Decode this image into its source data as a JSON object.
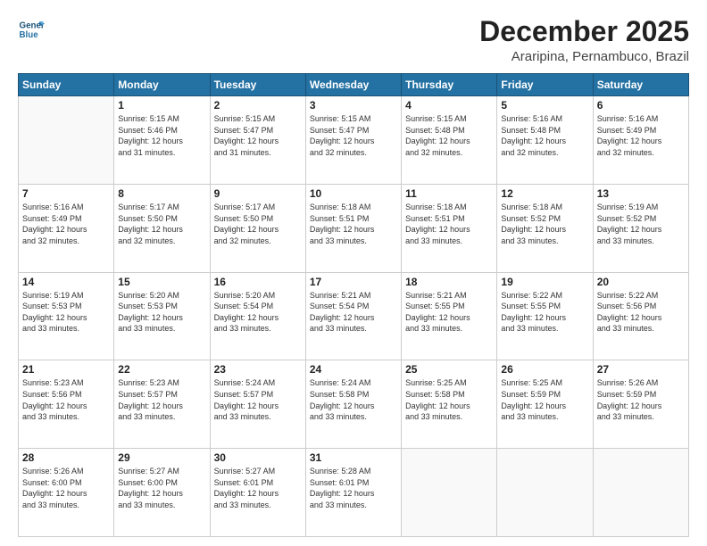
{
  "logo": {
    "line1": "General",
    "line2": "Blue"
  },
  "title": "December 2025",
  "subtitle": "Araripina, Pernambuco, Brazil",
  "weekdays": [
    "Sunday",
    "Monday",
    "Tuesday",
    "Wednesday",
    "Thursday",
    "Friday",
    "Saturday"
  ],
  "weeks": [
    [
      {
        "day": "",
        "info": ""
      },
      {
        "day": "1",
        "info": "Sunrise: 5:15 AM\nSunset: 5:46 PM\nDaylight: 12 hours\nand 31 minutes."
      },
      {
        "day": "2",
        "info": "Sunrise: 5:15 AM\nSunset: 5:47 PM\nDaylight: 12 hours\nand 31 minutes."
      },
      {
        "day": "3",
        "info": "Sunrise: 5:15 AM\nSunset: 5:47 PM\nDaylight: 12 hours\nand 32 minutes."
      },
      {
        "day": "4",
        "info": "Sunrise: 5:15 AM\nSunset: 5:48 PM\nDaylight: 12 hours\nand 32 minutes."
      },
      {
        "day": "5",
        "info": "Sunrise: 5:16 AM\nSunset: 5:48 PM\nDaylight: 12 hours\nand 32 minutes."
      },
      {
        "day": "6",
        "info": "Sunrise: 5:16 AM\nSunset: 5:49 PM\nDaylight: 12 hours\nand 32 minutes."
      }
    ],
    [
      {
        "day": "7",
        "info": "Sunrise: 5:16 AM\nSunset: 5:49 PM\nDaylight: 12 hours\nand 32 minutes."
      },
      {
        "day": "8",
        "info": "Sunrise: 5:17 AM\nSunset: 5:50 PM\nDaylight: 12 hours\nand 32 minutes."
      },
      {
        "day": "9",
        "info": "Sunrise: 5:17 AM\nSunset: 5:50 PM\nDaylight: 12 hours\nand 32 minutes."
      },
      {
        "day": "10",
        "info": "Sunrise: 5:18 AM\nSunset: 5:51 PM\nDaylight: 12 hours\nand 33 minutes."
      },
      {
        "day": "11",
        "info": "Sunrise: 5:18 AM\nSunset: 5:51 PM\nDaylight: 12 hours\nand 33 minutes."
      },
      {
        "day": "12",
        "info": "Sunrise: 5:18 AM\nSunset: 5:52 PM\nDaylight: 12 hours\nand 33 minutes."
      },
      {
        "day": "13",
        "info": "Sunrise: 5:19 AM\nSunset: 5:52 PM\nDaylight: 12 hours\nand 33 minutes."
      }
    ],
    [
      {
        "day": "14",
        "info": "Sunrise: 5:19 AM\nSunset: 5:53 PM\nDaylight: 12 hours\nand 33 minutes."
      },
      {
        "day": "15",
        "info": "Sunrise: 5:20 AM\nSunset: 5:53 PM\nDaylight: 12 hours\nand 33 minutes."
      },
      {
        "day": "16",
        "info": "Sunrise: 5:20 AM\nSunset: 5:54 PM\nDaylight: 12 hours\nand 33 minutes."
      },
      {
        "day": "17",
        "info": "Sunrise: 5:21 AM\nSunset: 5:54 PM\nDaylight: 12 hours\nand 33 minutes."
      },
      {
        "day": "18",
        "info": "Sunrise: 5:21 AM\nSunset: 5:55 PM\nDaylight: 12 hours\nand 33 minutes."
      },
      {
        "day": "19",
        "info": "Sunrise: 5:22 AM\nSunset: 5:55 PM\nDaylight: 12 hours\nand 33 minutes."
      },
      {
        "day": "20",
        "info": "Sunrise: 5:22 AM\nSunset: 5:56 PM\nDaylight: 12 hours\nand 33 minutes."
      }
    ],
    [
      {
        "day": "21",
        "info": "Sunrise: 5:23 AM\nSunset: 5:56 PM\nDaylight: 12 hours\nand 33 minutes."
      },
      {
        "day": "22",
        "info": "Sunrise: 5:23 AM\nSunset: 5:57 PM\nDaylight: 12 hours\nand 33 minutes."
      },
      {
        "day": "23",
        "info": "Sunrise: 5:24 AM\nSunset: 5:57 PM\nDaylight: 12 hours\nand 33 minutes."
      },
      {
        "day": "24",
        "info": "Sunrise: 5:24 AM\nSunset: 5:58 PM\nDaylight: 12 hours\nand 33 minutes."
      },
      {
        "day": "25",
        "info": "Sunrise: 5:25 AM\nSunset: 5:58 PM\nDaylight: 12 hours\nand 33 minutes."
      },
      {
        "day": "26",
        "info": "Sunrise: 5:25 AM\nSunset: 5:59 PM\nDaylight: 12 hours\nand 33 minutes."
      },
      {
        "day": "27",
        "info": "Sunrise: 5:26 AM\nSunset: 5:59 PM\nDaylight: 12 hours\nand 33 minutes."
      }
    ],
    [
      {
        "day": "28",
        "info": "Sunrise: 5:26 AM\nSunset: 6:00 PM\nDaylight: 12 hours\nand 33 minutes."
      },
      {
        "day": "29",
        "info": "Sunrise: 5:27 AM\nSunset: 6:00 PM\nDaylight: 12 hours\nand 33 minutes."
      },
      {
        "day": "30",
        "info": "Sunrise: 5:27 AM\nSunset: 6:01 PM\nDaylight: 12 hours\nand 33 minutes."
      },
      {
        "day": "31",
        "info": "Sunrise: 5:28 AM\nSunset: 6:01 PM\nDaylight: 12 hours\nand 33 minutes."
      },
      {
        "day": "",
        "info": ""
      },
      {
        "day": "",
        "info": ""
      },
      {
        "day": "",
        "info": ""
      }
    ]
  ]
}
